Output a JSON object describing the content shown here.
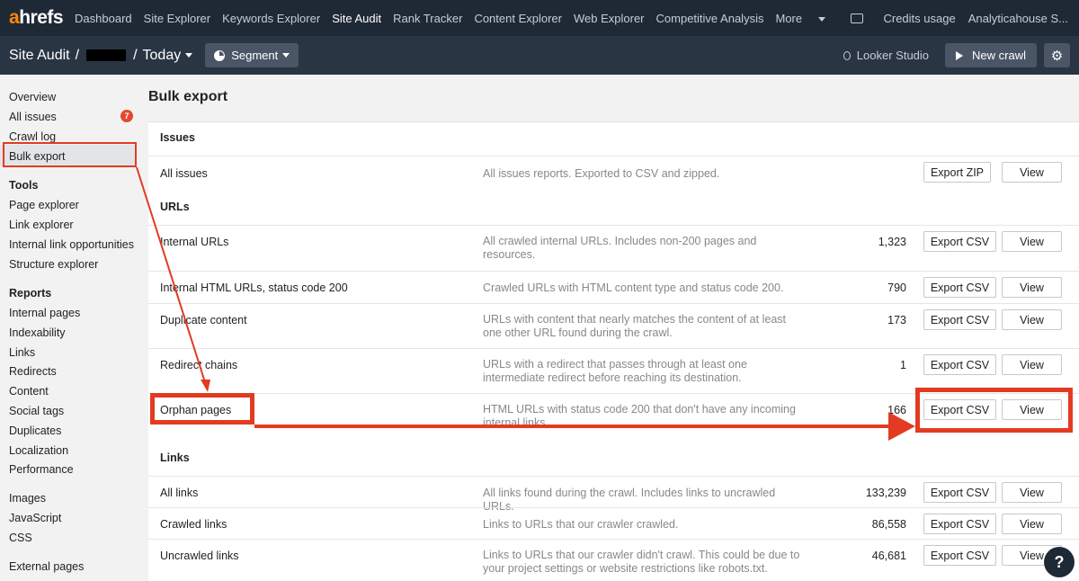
{
  "topnav": {
    "logo_a": "a",
    "logo_rest": "hrefs",
    "links": [
      "Dashboard",
      "Site Explorer",
      "Keywords Explorer",
      "Site Audit",
      "Rank Tracker",
      "Content Explorer",
      "Web Explorer",
      "Competitive Analysis",
      "More"
    ],
    "active_link": "Site Audit",
    "credits": "Credits usage",
    "account": "Analyticahouse S..."
  },
  "subhead": {
    "tool": "Site Audit",
    "separator": "/",
    "date": "Today",
    "segment": "Segment",
    "looker": "Looker Studio",
    "new_crawl": "New crawl"
  },
  "sidebar": {
    "items_top": [
      "Overview",
      "All issues",
      "Crawl log",
      "Bulk export"
    ],
    "issues_badge": "7",
    "tools_heading": "Tools",
    "tools": [
      "Page explorer",
      "Link explorer",
      "Internal link opportunities",
      "Structure explorer"
    ],
    "reports_heading": "Reports",
    "reports": [
      "Internal pages",
      "Indexability",
      "Links",
      "Redirects",
      "Content",
      "Social tags",
      "Duplicates",
      "Localization",
      "Performance"
    ],
    "extra": [
      "Images",
      "JavaScript",
      "CSS"
    ],
    "external": [
      "External pages"
    ]
  },
  "main": {
    "title": "Bulk export",
    "sections": {
      "issues": "Issues",
      "urls": "URLs",
      "links": "Links"
    },
    "rows": [
      {
        "name": "All issues",
        "desc": "All issues reports. Exported to CSV and zipped.",
        "count": "",
        "export": "Export ZIP",
        "view": "View"
      },
      {
        "name": "Internal URLs",
        "desc": "All crawled internal URLs. Includes non-200 pages and resources.",
        "count": "1,323",
        "export": "Export CSV",
        "view": "View"
      },
      {
        "name": "Internal HTML URLs, status code 200",
        "desc": "Crawled URLs with HTML content type and status code 200.",
        "count": "790",
        "export": "Export CSV",
        "view": "View"
      },
      {
        "name": "Duplicate content",
        "desc": "URLs with content that nearly matches the content of at least one other URL found during the crawl.",
        "count": "173",
        "export": "Export CSV",
        "view": "View"
      },
      {
        "name": "Redirect chains",
        "desc": "URLs with a redirect that passes through at least one intermediate redirect before reaching its destination.",
        "count": "1",
        "export": "Export CSV",
        "view": "View"
      },
      {
        "name": "Orphan pages",
        "desc": "HTML URLs with status code 200 that don't have any incoming internal links.",
        "count": "166",
        "export": "Export CSV",
        "view": "View"
      },
      {
        "name": "All links",
        "desc": "All links found during the crawl. Includes links to uncrawled URLs.",
        "count": "133,239",
        "export": "Export CSV",
        "view": "View"
      },
      {
        "name": "Crawled links",
        "desc": "Links to URLs that our crawler crawled.",
        "count": "86,558",
        "export": "Export CSV",
        "view": "View"
      },
      {
        "name": "Uncrawled links",
        "desc": "Links to URLs that our crawler didn't crawl. This could be due to your project settings or website restrictions like robots.txt.",
        "count": "46,681",
        "export": "Export CSV",
        "view": "View"
      }
    ]
  },
  "help": "?",
  "colors": {
    "accent": "#ff8800",
    "annotation": "#e23b22",
    "nav_bg": "#1f2936",
    "badge": "#e4492b"
  },
  "icons": [
    "screen-icon",
    "pie-icon",
    "looker-icon",
    "play-icon",
    "gear-icon",
    "help-icon"
  ]
}
